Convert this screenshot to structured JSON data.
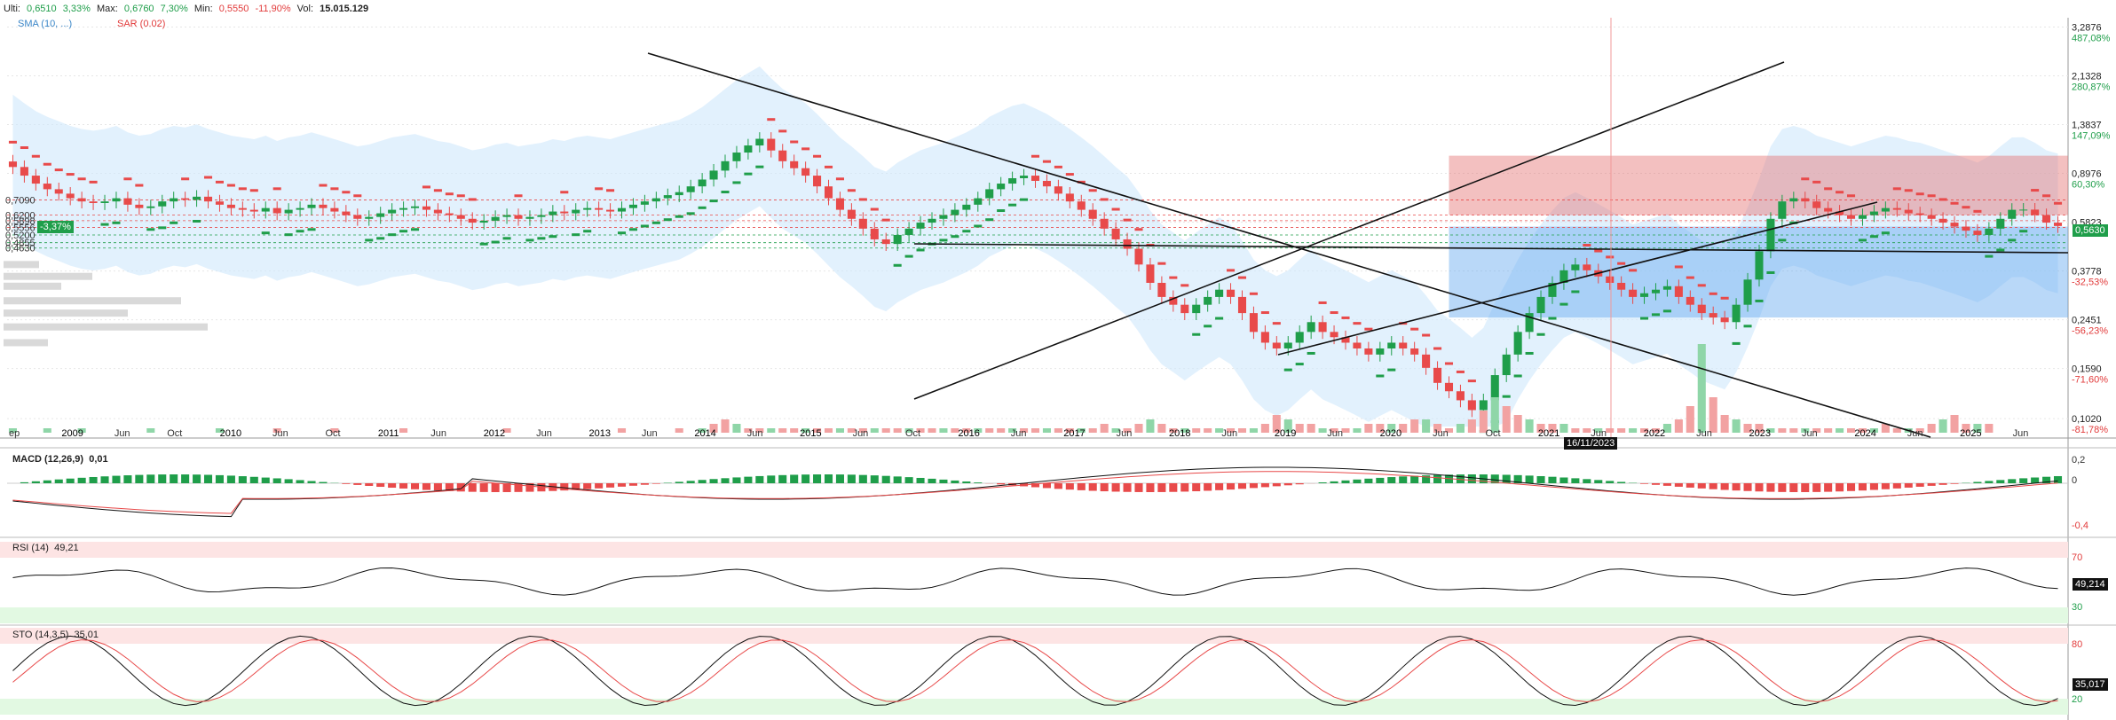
{
  "header": {
    "ulti_label": "Ulti:",
    "ulti_value": "0,6510",
    "ulti_chg": "3,33%",
    "max_label": "Max:",
    "max_value": "0,6760",
    "max_chg": "7,30%",
    "min_label": "Min:",
    "min_value": "0,5550",
    "min_chg": "-11,90%",
    "vol_label": "Vol:",
    "vol_value": "15.015.129",
    "sma_label": "SMA (10, ...)",
    "sar_label": "SAR (0.02)"
  },
  "price_axis": {
    "ticks": [
      "3,2876",
      "2,1328",
      "1,3837",
      "0,8976",
      "0,5823",
      "0,3778",
      "0,2451",
      "0,1590",
      "0,1020"
    ],
    "pcts": [
      "487,08%",
      "280,87%",
      "147,09%",
      "60,30%",
      "",
      "-32,53%",
      "-56,23%",
      "-71,60%",
      "-81,78%"
    ],
    "last": "0,5630"
  },
  "left_levels": [
    "0,7090",
    "0,6200",
    "0,5898",
    "0,5556",
    "0,5200",
    "0,4855",
    "0,4630"
  ],
  "left_tag": "-3,37%",
  "time_axis": {
    "labels": [
      "ep",
      "2009",
      "Jun",
      "Oct",
      "2010",
      "Jun",
      "Oct",
      "2011",
      "Jun",
      "2012",
      "Jun",
      "2013",
      "Jun",
      "2014",
      "Jun",
      "2015",
      "Jun",
      "Oct",
      "2016",
      "Jun",
      "2017",
      "Jun",
      "2018",
      "Jun",
      "2019",
      "Jun",
      "2020",
      "Jun",
      "Oct",
      "2021",
      "Jun",
      "2022",
      "Jun",
      "2023",
      "Jun",
      "2024",
      "Jun",
      "2025",
      "Jun"
    ],
    "cursor_date": "16/11/2023"
  },
  "macd": {
    "title": "MACD (12,26,9)",
    "value": "0,01",
    "ticks": [
      "0,2",
      "0",
      "-0,4"
    ]
  },
  "rsi": {
    "title": "RSI (14)",
    "value": "49,21",
    "ticks": [
      "70",
      "30"
    ],
    "last": "49,214"
  },
  "sto": {
    "title": "STO (14,3,5)",
    "value": "35,01",
    "ticks": [
      "80",
      "20"
    ],
    "last": "35,017"
  },
  "colors": {
    "up": "#1f9e4a",
    "down": "#e84a4a",
    "band": "#cfe8fb",
    "grid": "#e6e6e6"
  },
  "chart_data": {
    "type": "candlestick",
    "frequency": "monthly",
    "start": "2008-09",
    "close": [
      0.95,
      0.88,
      0.82,
      0.78,
      0.75,
      0.72,
      0.7,
      0.69,
      0.7,
      0.72,
      0.68,
      0.66,
      0.67,
      0.7,
      0.72,
      0.71,
      0.73,
      0.7,
      0.68,
      0.66,
      0.65,
      0.64,
      0.66,
      0.63,
      0.65,
      0.66,
      0.68,
      0.66,
      0.64,
      0.62,
      0.6,
      0.61,
      0.63,
      0.65,
      0.66,
      0.67,
      0.65,
      0.63,
      0.62,
      0.6,
      0.58,
      0.59,
      0.61,
      0.62,
      0.6,
      0.61,
      0.62,
      0.64,
      0.63,
      0.65,
      0.66,
      0.65,
      0.64,
      0.66,
      0.68,
      0.7,
      0.72,
      0.74,
      0.76,
      0.8,
      0.85,
      0.92,
      1.0,
      1.08,
      1.15,
      1.22,
      1.1,
      1.0,
      0.94,
      0.88,
      0.8,
      0.72,
      0.65,
      0.6,
      0.55,
      0.5,
      0.48,
      0.52,
      0.55,
      0.58,
      0.6,
      0.62,
      0.65,
      0.68,
      0.72,
      0.78,
      0.82,
      0.86,
      0.88,
      0.84,
      0.8,
      0.75,
      0.7,
      0.65,
      0.6,
      0.55,
      0.5,
      0.46,
      0.4,
      0.34,
      0.3,
      0.28,
      0.26,
      0.28,
      0.3,
      0.32,
      0.3,
      0.26,
      0.22,
      0.2,
      0.19,
      0.2,
      0.22,
      0.24,
      0.22,
      0.21,
      0.2,
      0.19,
      0.18,
      0.19,
      0.2,
      0.19,
      0.18,
      0.16,
      0.14,
      0.13,
      0.12,
      0.11,
      0.12,
      0.15,
      0.18,
      0.22,
      0.26,
      0.3,
      0.34,
      0.38,
      0.4,
      0.38,
      0.36,
      0.34,
      0.32,
      0.3,
      0.31,
      0.32,
      0.33,
      0.3,
      0.28,
      0.26,
      0.25,
      0.24,
      0.28,
      0.35,
      0.45,
      0.6,
      0.7,
      0.72,
      0.7,
      0.66,
      0.64,
      0.62,
      0.6,
      0.62,
      0.64,
      0.66,
      0.65,
      0.63,
      0.62,
      0.6,
      0.58,
      0.56,
      0.54,
      0.52,
      0.55,
      0.6,
      0.65,
      0.651,
      0.62,
      0.58,
      0.563
    ],
    "ylabel": "",
    "yscale": "log",
    "ylim": [
      0.09,
      3.3
    ],
    "volume": [
      1,
      0,
      0,
      1,
      0,
      0,
      1,
      0,
      0,
      0,
      0,
      0,
      1,
      0,
      0,
      0,
      0,
      0,
      1,
      0,
      0,
      0,
      0,
      1,
      0,
      0,
      0,
      0,
      1,
      0,
      0,
      0,
      0,
      0,
      1,
      0,
      0,
      0,
      0,
      0,
      0,
      0,
      0,
      1,
      0,
      0,
      0,
      0,
      0,
      0,
      0,
      0,
      0,
      1,
      0,
      0,
      0,
      0,
      1,
      0,
      1,
      2,
      3,
      2,
      1,
      1,
      1,
      1,
      1,
      1,
      1,
      1,
      1,
      1,
      1,
      1,
      1,
      1,
      1,
      1,
      1,
      1,
      1,
      1,
      1,
      1,
      1,
      1,
      1,
      1,
      1,
      1,
      1,
      1,
      1,
      2,
      1,
      1,
      2,
      3,
      2,
      1,
      1,
      1,
      1,
      1,
      1,
      1,
      1,
      2,
      4,
      3,
      2,
      2,
      1,
      1,
      1,
      1,
      2,
      2,
      2,
      2,
      3,
      3,
      2,
      1,
      2,
      3,
      5,
      8,
      6,
      4,
      3,
      2,
      2,
      2,
      1,
      1,
      1,
      1,
      1,
      1,
      1,
      1,
      2,
      3,
      6,
      20,
      8,
      4,
      3,
      2,
      2,
      1,
      1,
      1,
      1,
      1,
      1,
      1,
      1,
      1,
      1,
      2,
      1,
      1,
      1,
      2,
      3,
      4,
      2,
      2,
      2
    ]
  }
}
